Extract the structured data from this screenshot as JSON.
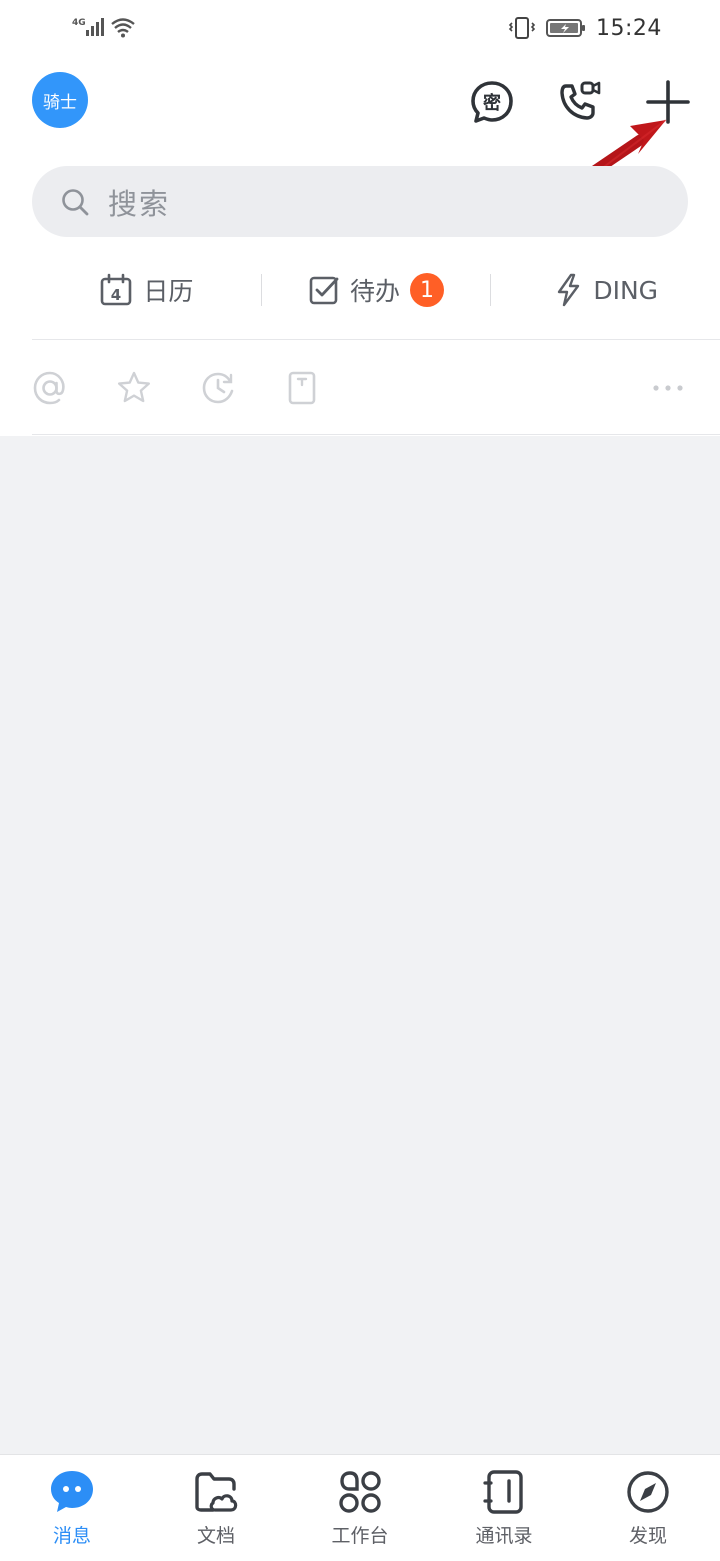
{
  "status_bar": {
    "network": "4G",
    "time": "15:24"
  },
  "header": {
    "avatar_text": "骑士",
    "secret_chat_icon": "secret-chat-icon",
    "call_icon": "video-call-icon",
    "add_icon": "plus-icon"
  },
  "search": {
    "placeholder": "搜索"
  },
  "quick_actions": [
    {
      "label": "日历",
      "icon": "calendar-icon",
      "calendar_day": "4"
    },
    {
      "label": "待办",
      "icon": "todo-check-icon",
      "badge": "1"
    },
    {
      "label": "DING",
      "icon": "lightning-icon"
    }
  ],
  "filters": [
    "at-icon",
    "star-icon",
    "clock-icon",
    "doc-icon",
    "more-icon"
  ],
  "nav": [
    {
      "label": "消息",
      "icon": "message-icon",
      "active": true
    },
    {
      "label": "文档",
      "icon": "folder-cloud-icon"
    },
    {
      "label": "工作台",
      "icon": "workbench-icon"
    },
    {
      "label": "通讯录",
      "icon": "contacts-icon"
    },
    {
      "label": "发现",
      "icon": "compass-icon"
    }
  ],
  "colors": {
    "accent": "#2c8ef6",
    "avatar_bg": "#3296fa",
    "badge": "#ff5f26",
    "content_bg": "#f1f2f4",
    "annotation_arrow": "#c0171b"
  }
}
